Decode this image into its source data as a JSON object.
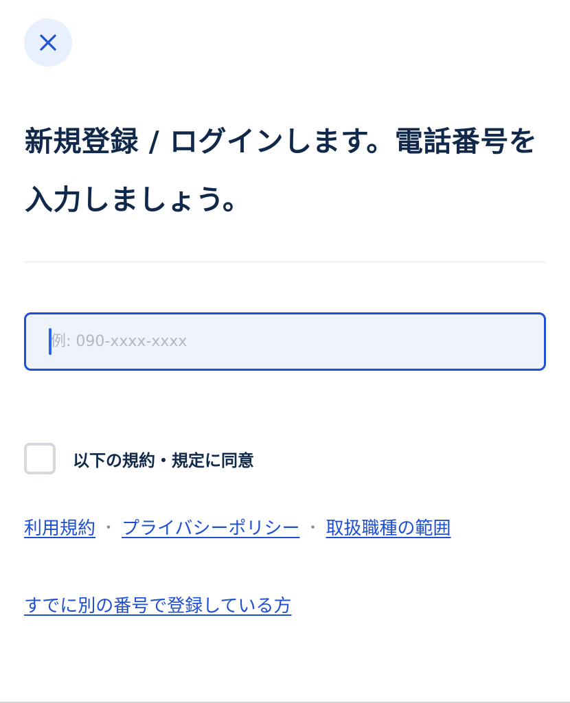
{
  "header": {
    "close_icon": "close-icon",
    "accent_color": "#1f4fd6"
  },
  "main": {
    "title": "新規登録 / ログインします。電話番号を入力しましょう。",
    "phone_input": {
      "value": "",
      "placeholder": "例: 090-xxxx-xxxx"
    },
    "agreement": {
      "checked": false,
      "label": "以下の規約・規定に同意"
    },
    "terms_links": {
      "terms_of_use": "利用規約",
      "separator_1": "・",
      "privacy_policy": "プライバシーポリシー",
      "separator_2": "・",
      "job_scope": "取扱職種の範囲"
    },
    "existing_account_link": "すでに別の番号で登録している方"
  }
}
